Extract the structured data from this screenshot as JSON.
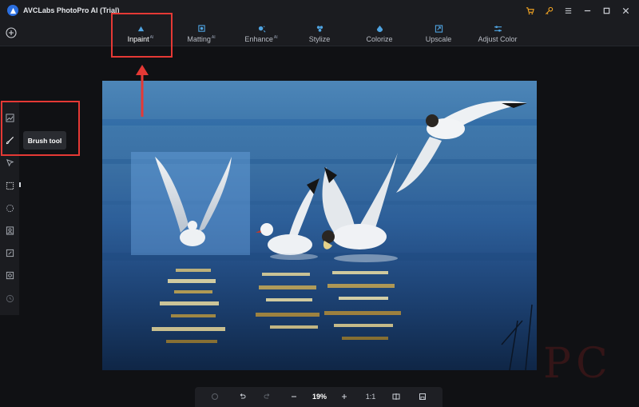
{
  "app": {
    "title": "AVCLabs PhotoPro AI (Trial)"
  },
  "toolbar": {
    "tools": [
      {
        "label": "Inpaint",
        "badge": "AI"
      },
      {
        "label": "Matting",
        "badge": "AI"
      },
      {
        "label": "Enhance",
        "badge": "AI"
      },
      {
        "label": "Stylize",
        "badge": ""
      },
      {
        "label": "Colorize",
        "badge": ""
      },
      {
        "label": "Upscale",
        "badge": ""
      },
      {
        "label": "Adjust Color",
        "badge": ""
      }
    ]
  },
  "sidebar": {
    "tooltip": "Brush tool"
  },
  "zoombar": {
    "zoom": "19%",
    "ratio": "1:1"
  },
  "colors": {
    "accent": "#e53935",
    "brand": "#2b6fe0",
    "cart": "#f5a623"
  }
}
